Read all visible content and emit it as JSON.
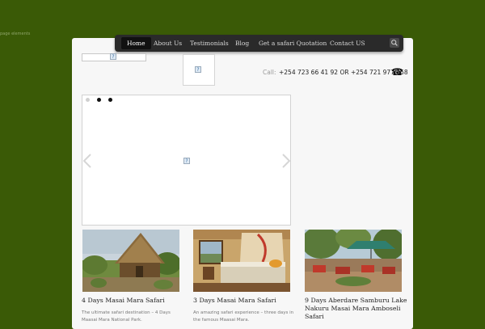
{
  "skip_link": "page elements",
  "nav": {
    "items": [
      {
        "label": "Home",
        "active": true
      },
      {
        "label": "About Us",
        "active": false
      },
      {
        "label": "Testimonials",
        "active": false
      },
      {
        "label": "Blog",
        "active": false
      },
      {
        "label": "Get a safari Quotation",
        "active": false
      },
      {
        "label": "Contact US",
        "active": false
      }
    ],
    "search_icon": "search-icon"
  },
  "header": {
    "logo_icon": "broken-image-icon",
    "call_label": "Call:",
    "call_numbers": "+254 723 66 41 92 OR +254 721 977 158",
    "phone_icon": "phone-icon"
  },
  "slider": {
    "slide_count": 3,
    "active_index": 1,
    "prev_icon": "chevron-left-icon",
    "next_icon": "chevron-right-icon"
  },
  "tours": [
    {
      "title": "4 Days Masai Mara Safari",
      "desc_line1": "The ultimate safari destination – 4 Days",
      "desc_line2": "Maasai Mara National Park."
    },
    {
      "title": "3 Days Masai Mara Safari",
      "desc_line1": "An amazing safari experience – three days in",
      "desc_line2": "the famous Maasai Mara."
    },
    {
      "title_line1": "9 Days Aberdare Samburu Lake",
      "title_line2": "Nakuru Masai Mara Amboseli",
      "title_line3": "Safari"
    }
  ],
  "colors": {
    "background": "#3a5a06",
    "nav_bg": "#2a2a2a",
    "card_bg": "#f7f7f7"
  }
}
